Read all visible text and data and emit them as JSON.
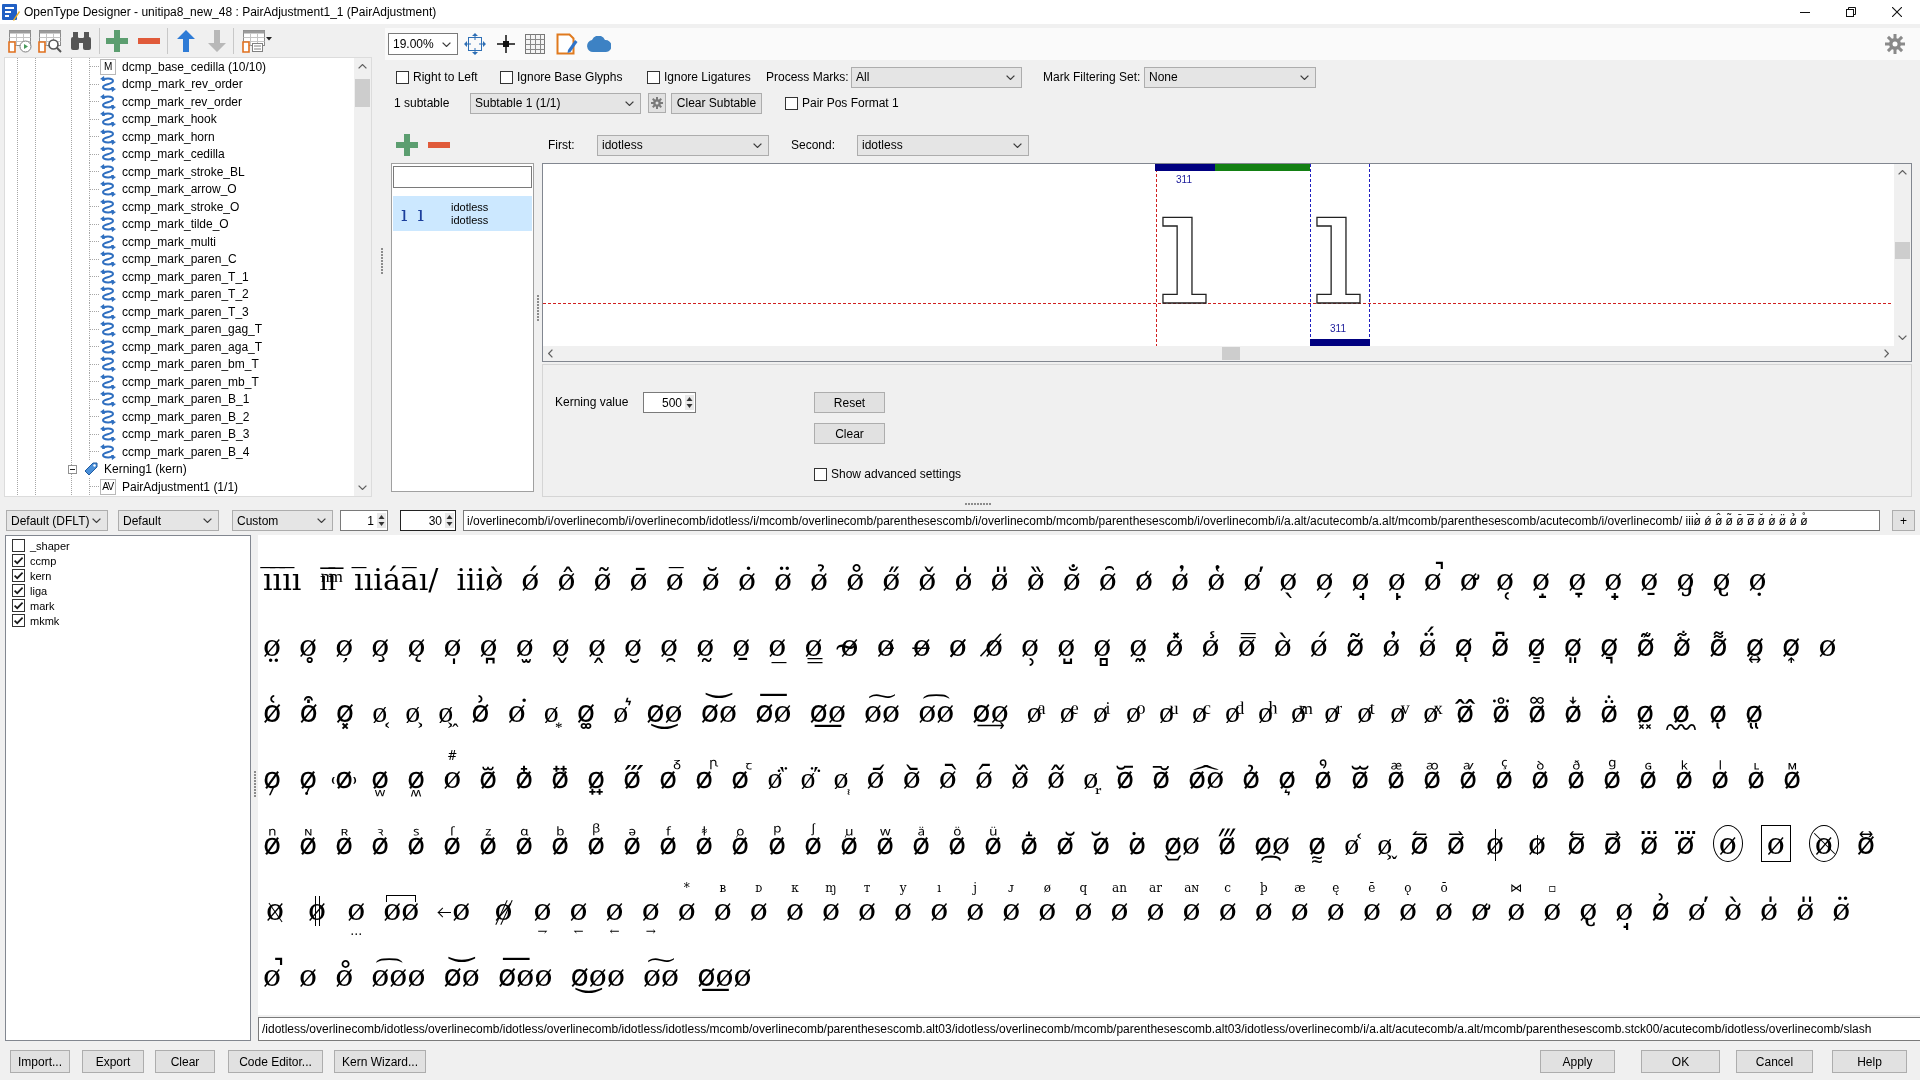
{
  "window": {
    "title": "OpenType Designer - unitipa8_new_48 : PairAdjustment1_1 (PairAdjustment)"
  },
  "tree": {
    "lookups": [
      {
        "label": "dcmp_base_cedilla (10/10)",
        "kind": "letter",
        "icon_text": "M"
      },
      {
        "label": "dcmp_mark_rev_order",
        "kind": "chain"
      },
      {
        "label": "ccmp_mark_rev_order",
        "kind": "chain"
      },
      {
        "label": "ccmp_mark_hook",
        "kind": "chain"
      },
      {
        "label": "ccmp_mark_horn",
        "kind": "chain"
      },
      {
        "label": "ccmp_mark_cedilla",
        "kind": "chain"
      },
      {
        "label": "ccmp_mark_stroke_BL",
        "kind": "chain"
      },
      {
        "label": "ccmp_mark_arrow_O",
        "kind": "chain"
      },
      {
        "label": "ccmp_mark_stroke_O",
        "kind": "chain"
      },
      {
        "label": "ccmp_mark_tilde_O",
        "kind": "chain"
      },
      {
        "label": "ccmp_mark_multi",
        "kind": "chain"
      },
      {
        "label": "ccmp_mark_paren_C",
        "kind": "chain"
      },
      {
        "label": "ccmp_mark_paren_T_1",
        "kind": "chain"
      },
      {
        "label": "ccmp_mark_paren_T_2",
        "kind": "chain"
      },
      {
        "label": "ccmp_mark_paren_T_3",
        "kind": "chain"
      },
      {
        "label": "ccmp_mark_paren_gag_T",
        "kind": "chain"
      },
      {
        "label": "ccmp_mark_paren_aga_T",
        "kind": "chain"
      },
      {
        "label": "ccmp_mark_paren_bm_T",
        "kind": "chain"
      },
      {
        "label": "ccmp_mark_paren_mb_T",
        "kind": "chain"
      },
      {
        "label": "ccmp_mark_paren_B_1",
        "kind": "chain"
      },
      {
        "label": "ccmp_mark_paren_B_2",
        "kind": "chain"
      },
      {
        "label": "ccmp_mark_paren_B_3",
        "kind": "chain"
      },
      {
        "label": "ccmp_mark_paren_B_4",
        "kind": "chain"
      }
    ],
    "features": [
      {
        "label": "Kerning1 (kern)",
        "expanded": true,
        "children": [
          {
            "label": "PairAdjustment1 (1/1)",
            "kind": "letter",
            "icon_text": "AV"
          }
        ]
      }
    ]
  },
  "zoom": {
    "value": "19.00%"
  },
  "options": [
    {
      "label": "Right to Left",
      "checked": false
    },
    {
      "label": "Ignore Base Glyphs",
      "checked": false
    },
    {
      "label": "Ignore Ligatures",
      "checked": false
    }
  ],
  "process_marks": {
    "label": "Process Marks:",
    "value": "All"
  },
  "mark_filtering_set": {
    "label": "Mark Filtering Set:",
    "value": "None"
  },
  "subtable": {
    "count": "1 subtable",
    "value": "Subtable 1 (1/1)",
    "clear_button": "Clear Subtable",
    "pair_pos_format": {
      "label": "Pair Pos Format 1",
      "checked": false
    }
  },
  "pair": {
    "first": {
      "label": "First:",
      "value": "idotless"
    },
    "second": {
      "label": "Second:",
      "value": "idotless"
    }
  },
  "pair_list": {
    "items": [
      {
        "first_glyph": "ı",
        "second_glyph": "ı",
        "first": "idotless",
        "second": "idotless",
        "selected": true
      }
    ]
  },
  "preview": {
    "first_glyph": "ı",
    "second_glyph": "ı",
    "first_advance": "311",
    "second_advance": "311"
  },
  "kerning": {
    "label": "Kerning value",
    "value": "500",
    "reset_button": "Reset",
    "clear_button": "Clear",
    "advanced": {
      "label": "Show advanced settings",
      "checked": false
    }
  },
  "text_settings": {
    "script": "Default (DFLT)",
    "language": "Default",
    "mode": "Custom",
    "start": "1",
    "size": "30",
    "text": "i/overlinecomb/i/overlinecomb/i/overlinecomb/idotless/i/mcomb/overlinecomb/parenthesescomb/i/overlinecomb/mcomb/parenthesescomb/i/overlinecomb/i/a.alt/acutecomb/a.alt/mcomb/parenthesescomb/acutecomb/i/overlinecomb/ iiiø̀ ǿ ø̂ ø̃ ø̄ ø̅ ø̆ ø̇ ø̈ ø̉ ø̊",
    "add_button": "+"
  },
  "features": [
    {
      "label": "_shaper",
      "checked": false
    },
    {
      "label": "ccmp",
      "checked": true
    },
    {
      "label": "kern",
      "checked": true
    },
    {
      "label": "liga",
      "checked": true
    },
    {
      "label": "mark",
      "checked": true
    },
    {
      "label": "mkmk",
      "checked": true
    }
  ],
  "sample": {
    "lines": [
      [
        "ı̅ı̅ı̅ı ı̅ͫı̅ͫ ı̅ıiáa̅ı/ iiiø̀ ǿ ø̂ ø̃ ø̄ ø̅ ø̆ ø̇ ø̈ ø̉ ø̊ ø̋ ø̌ ø̍ ø̎ ø̏ ø̐ ø̑ ø̒ ø̓ ø̔ ø̕ ø̖ ø̗ ø̘ ø̙ ø̚ ø̛ ø̜ ø̝ ø̞ ø̟ ø̠ ø̡ ø̢ ø̣"
      ],
      [
        "ø̤ ø̥ ø̦ ø̧ ø̨ ø̩ ø̪ ø̫ ø̬ ø̭ ø̮ ø̯ ø̰ ø̱ ø̲ ø̳ ø̴ ø̵ ø̶ ø̷ ø̸ ø̹ ø̺ ø̻ ø̼ ø̽ ø̾ ø̿ ø̀ ǿ ø͂ ø̓ ø̈́ øͅ ø͆ ø͇ ø͈ ø͉ ø͊ ø͋ ø͌ ø͍ ø͎ ø"
      ],
      [
        "ø͑ ø͒ ø͓ ø͔ ø͕ ø͖ ø͗ ø͘ ø͙ ø͚ ø͛ ø͜ø ø͝ø ø͞ø ø͟ø ø͠ø ø͡ø ø͢ø øͣ øͤ øͥ øͦ øͧ øͨ øͩ øͪ øͫ øͬ øͭ øͮ øͯ ø᪰ ø᪱ ø᪲ ø᪳ ø᪴ ø᪵ ø᪶ ø᪷ ø᪸"
      ],
      [
        "ø᪹ ø᪺ ø᪾ øᪿ øᫀ",
        {
          "kind": "above",
          "text": "ø",
          "mark": "#"
        },
        "ø᫇ ø᫈ ø᫉ ø᫊ ø᫋ øᫌ øᫍ øᫎ ø᷀ ø᷁ ø᷂ ø᷄ ø᷅ ø᷆ ø᷇ ø᷈ ø᷉ ø᷊ ø᷋ ø᷌ ø᷍ø ø᷎ ø᷏ ø᷒ øᷓ øᷔ øᷕ øᷖ øᷗ øᷘ øᷙ øᷚ øᷛ øᷜ øᷝ øᷞ øᷟ"
      ],
      [
        "øᷠ øᷡ øᷢ øᷣ øᷤ øᷥ øᷦ øᷧ øᷨ øᷩ øᷪ øᷫ øᷬ øᷭ øᷮ øᷯ øᷰ øᷱ øᷲ øᷳ øᷴ ø᷵ ø᷶ ø᷷ ø᷸ ø᷹ø ø᷻ ø᷼ø ø᷽ ø᷾ ø᷿ ø⃐ ø⃑",
        {
          "kind": "barred",
          "text": "ø"
        },
        {
          "kind": "shortbarred",
          "text": "ø"
        },
        "ø⃖ ø⃗ ø⃛ ø⃜",
        {
          "kind": "circled",
          "text": "ø"
        },
        {
          "kind": "boxed",
          "text": "ø"
        },
        {
          "kind": "circleslashed",
          "text": "ø"
        },
        "ø⃡"
      ],
      [
        {
          "kind": "backslashed",
          "text": "ø"
        },
        {
          "kind": "doublebarred",
          "text": "ø"
        },
        {
          "kind": "below",
          "text": "ø",
          "mark": "…"
        },
        {
          "kind": "bridged",
          "text": "øø"
        },
        {
          "kind": "leftarrowed",
          "text": "ø"
        },
        {
          "kind": "doubleslashed",
          "text": "ø"
        },
        {
          "kind": "below",
          "text": "ø",
          "mark": "⇁"
        },
        {
          "kind": "below",
          "text": "ø",
          "mark": "↽"
        },
        {
          "kind": "below",
          "text": "ø",
          "mark": "←"
        },
        {
          "kind": "below",
          "text": "ø",
          "mark": "→"
        },
        {
          "kind": "above",
          "text": "ø",
          "mark": "*"
        },
        {
          "kind": "above",
          "text": "ø",
          "mark": "ʙ"
        },
        {
          "kind": "above",
          "text": "ø",
          "mark": "ᴅ"
        },
        {
          "kind": "above",
          "text": "ø",
          "mark": "ᴋ"
        },
        {
          "kind": "above",
          "text": "ø",
          "mark": "ɱ"
        },
        {
          "kind": "above",
          "text": "ø",
          "mark": "ᴛ"
        },
        {
          "kind": "above",
          "text": "ø",
          "mark": "y"
        },
        {
          "kind": "above",
          "text": "ø",
          "mark": "ı"
        },
        {
          "kind": "above",
          "text": "ø",
          "mark": "j"
        },
        {
          "kind": "above",
          "text": "ø",
          "mark": "ᴊ"
        },
        {
          "kind": "above",
          "text": "ø",
          "mark": "ø"
        },
        {
          "kind": "above",
          "text": "ø",
          "mark": "q"
        },
        {
          "kind": "above",
          "text": "ø",
          "mark": "an"
        },
        {
          "kind": "above",
          "text": "ø",
          "mark": "ar"
        },
        {
          "kind": "above",
          "text": "ø",
          "mark": "aɴ"
        },
        {
          "kind": "above",
          "text": "ø",
          "mark": "c"
        },
        {
          "kind": "above",
          "text": "ø",
          "mark": "þ"
        },
        {
          "kind": "above",
          "text": "ø",
          "mark": "æ"
        },
        {
          "kind": "above",
          "text": "ø",
          "mark": "ę"
        },
        {
          "kind": "above",
          "text": "ø",
          "mark": "ē"
        },
        {
          "kind": "above",
          "text": "ø",
          "mark": "ǫ"
        },
        {
          "kind": "above",
          "text": "ø",
          "mark": "ō"
        },
        "ø̛",
        {
          "kind": "above",
          "text": "ø",
          "mark": "⋈"
        },
        {
          "kind": "above",
          "text": "ø",
          "mark": "▫"
        },
        "ø̢ ø̘ ø͗ ø̕ ø̀ ø̍ ø̎ ø̈"
      ],
      [
        "ø̚ ø ø̊ ø͡øø ø͝ø ø͞øø ø͜øø ø͠ø ø͟øø"
      ]
    ]
  },
  "glyph_path": "/idotless/overlinecomb/idotless/overlinecomb/idotless/overlinecomb/idotless/idotless/mcomb/overlinecomb/parenthesescomb.alt03/idotless/overlinecomb/mcomb/parenthesescomb.alt03/idotless/overlinecomb/i/a.alt/acutecomb/a.alt/mcomb/parenthesescomb.stck00/acutecomb/idotless/overlinecomb/slash",
  "footer": {
    "left_buttons": [
      "Import...",
      "Export",
      "Clear",
      "Code Editor...",
      "Kern Wizard..."
    ],
    "right_buttons": [
      "Apply",
      "OK",
      "Cancel",
      "Help"
    ]
  }
}
